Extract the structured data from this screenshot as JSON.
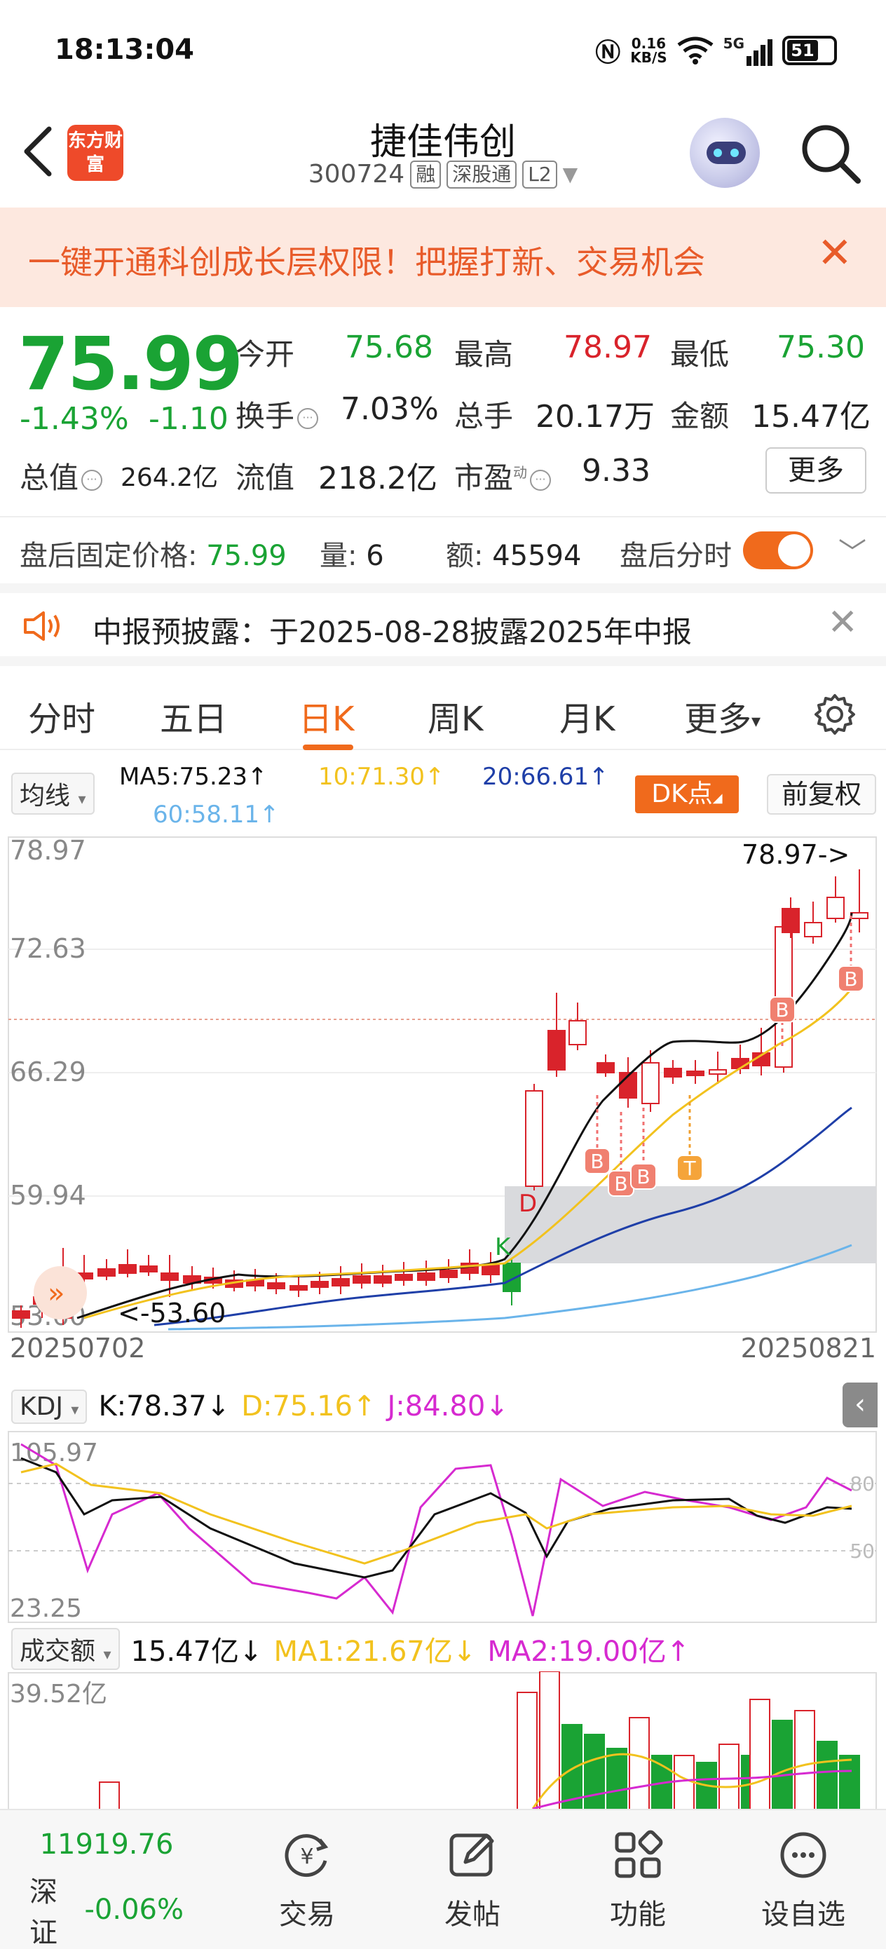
{
  "status_bar": {
    "time": "18:13:04",
    "net_speed_value": "0.16",
    "net_speed_unit": "KB/S",
    "network": "5G",
    "battery": "51"
  },
  "header": {
    "app_logo": "东方财富",
    "stock_name": "捷佳伟创",
    "stock_code": "300724",
    "tags": [
      "融",
      "深股通",
      "L2"
    ]
  },
  "banner": {
    "text": "一键开通科创成长层权限！把握打新、交易机会"
  },
  "quote": {
    "price": "75.99",
    "change_pct": "-1.43%",
    "change": "-1.10",
    "open_label": "今开",
    "open": "75.68",
    "high_label": "最高",
    "high": "78.97",
    "low_label": "最低",
    "low": "75.30",
    "turnover_label": "换手",
    "turnover": "7.03%",
    "volume_label": "总手",
    "volume": "20.17万",
    "amount_label": "金额",
    "amount": "15.47亿",
    "market_cap_label": "总值",
    "market_cap": "264.2亿",
    "float_cap_label": "流值",
    "float_cap": "218.2亿",
    "pe_label": "市盈",
    "pe_sup": "动",
    "pe": "9.33",
    "more": "更多"
  },
  "after_hours": {
    "price_label": "盘后固定价格:",
    "price": "75.99",
    "qty_label": "量:",
    "qty": "6",
    "amount_label": "额:",
    "amount": "45594",
    "toggle_label": "盘后分时",
    "toggle_on": true
  },
  "notice": {
    "text": "中报预披露：于2025-08-28披露2025年中报"
  },
  "tabs": [
    "分时",
    "五日",
    "日K",
    "周K",
    "月K",
    "更多"
  ],
  "active_tab": "日K",
  "ma_row": {
    "selector": "均线",
    "ma5": "MA5:75.23↑",
    "ma10": "10:71.30↑",
    "ma20": "20:66.61↑",
    "ma60": "60:58.11↑",
    "dk_button": "DK点",
    "adjust_button": "前复权"
  },
  "kline": {
    "y_labels": [
      "78.97",
      "72.63",
      "66.29",
      "59.94",
      "53.60"
    ],
    "high_label": "78.97->",
    "low_label": "<-53.60",
    "start_date": "20250702",
    "end_date": "20250821",
    "marks": [
      "B",
      "B",
      "B",
      "B",
      "B",
      "B",
      "T",
      "D",
      "K"
    ]
  },
  "kdj": {
    "selector": "KDJ",
    "k": "K:78.37↓",
    "d": "D:75.16↑",
    "j": "J:84.80↓",
    "y_top": "105.97",
    "y_bottom": "23.25",
    "ref_80": "80",
    "ref_50": "50"
  },
  "volume": {
    "selector": "成交额",
    "value": "15.47亿↓",
    "ma1": "MA1:21.67亿↓",
    "ma2": "MA2:19.00亿↑",
    "y_top": "39.52亿"
  },
  "colors": {
    "up": "#d9232b",
    "down": "#1aa334",
    "accent": "#f06a1c",
    "ma5": "#111111",
    "ma10": "#f2c21e",
    "ma20": "#1f3fa8",
    "ma60": "#6ab4ea",
    "j": "#d62ad0"
  },
  "bottom_nav": {
    "index_value": "11919.76",
    "index_name": "深证",
    "index_change": "-0.06%",
    "items": [
      "交易",
      "发帖",
      "功能",
      "设自选"
    ]
  }
}
